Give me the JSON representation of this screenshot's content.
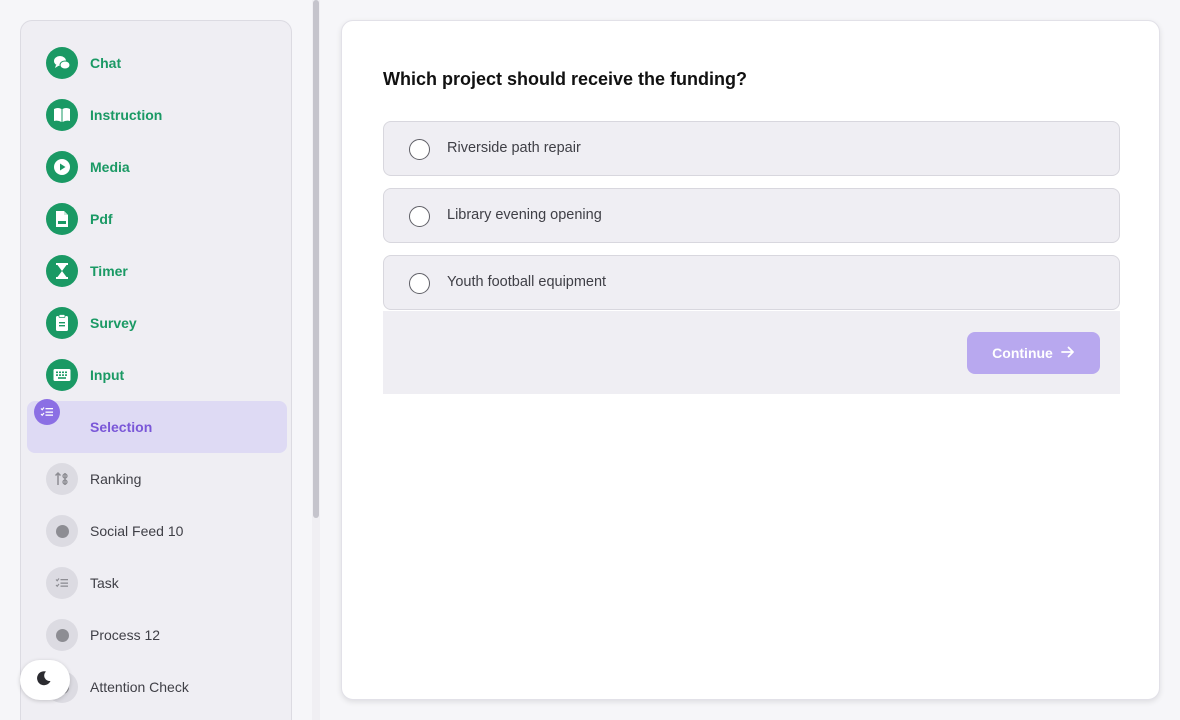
{
  "sidebar": {
    "steps": [
      {
        "label": "Chat",
        "icon": "chat-bubbles-icon",
        "state": "done"
      },
      {
        "label": "Instruction",
        "icon": "book-icon",
        "state": "done"
      },
      {
        "label": "Media",
        "icon": "play-icon",
        "state": "done"
      },
      {
        "label": "Pdf",
        "icon": "pdf-file-icon",
        "state": "done"
      },
      {
        "label": "Timer",
        "icon": "hourglass-icon",
        "state": "done"
      },
      {
        "label": "Survey",
        "icon": "clipboard-icon",
        "state": "done"
      },
      {
        "label": "Input",
        "icon": "keyboard-icon",
        "state": "done"
      },
      {
        "label": "Selection",
        "icon": "checklist-icon",
        "state": "active"
      },
      {
        "label": "Ranking",
        "icon": "sort-icon",
        "state": "future"
      },
      {
        "label": "Social Feed 10",
        "icon": "dot-icon",
        "state": "future"
      },
      {
        "label": "Task",
        "icon": "checklist-icon",
        "state": "future"
      },
      {
        "label": "Process 12",
        "icon": "dot-icon",
        "state": "future"
      },
      {
        "label": "Attention Check",
        "icon": "dot-icon",
        "state": "future"
      }
    ]
  },
  "theme_toggle": {
    "icon": "moon-icon"
  },
  "main": {
    "question": "Which project should receive the funding?",
    "options": [
      "Riverside path repair",
      "Library evening opening",
      "Youth football equipment"
    ],
    "continue_label": "Continue"
  },
  "colors": {
    "done": "#1a9964",
    "active": "#8b6fe4",
    "button": "#b8a8ef"
  }
}
